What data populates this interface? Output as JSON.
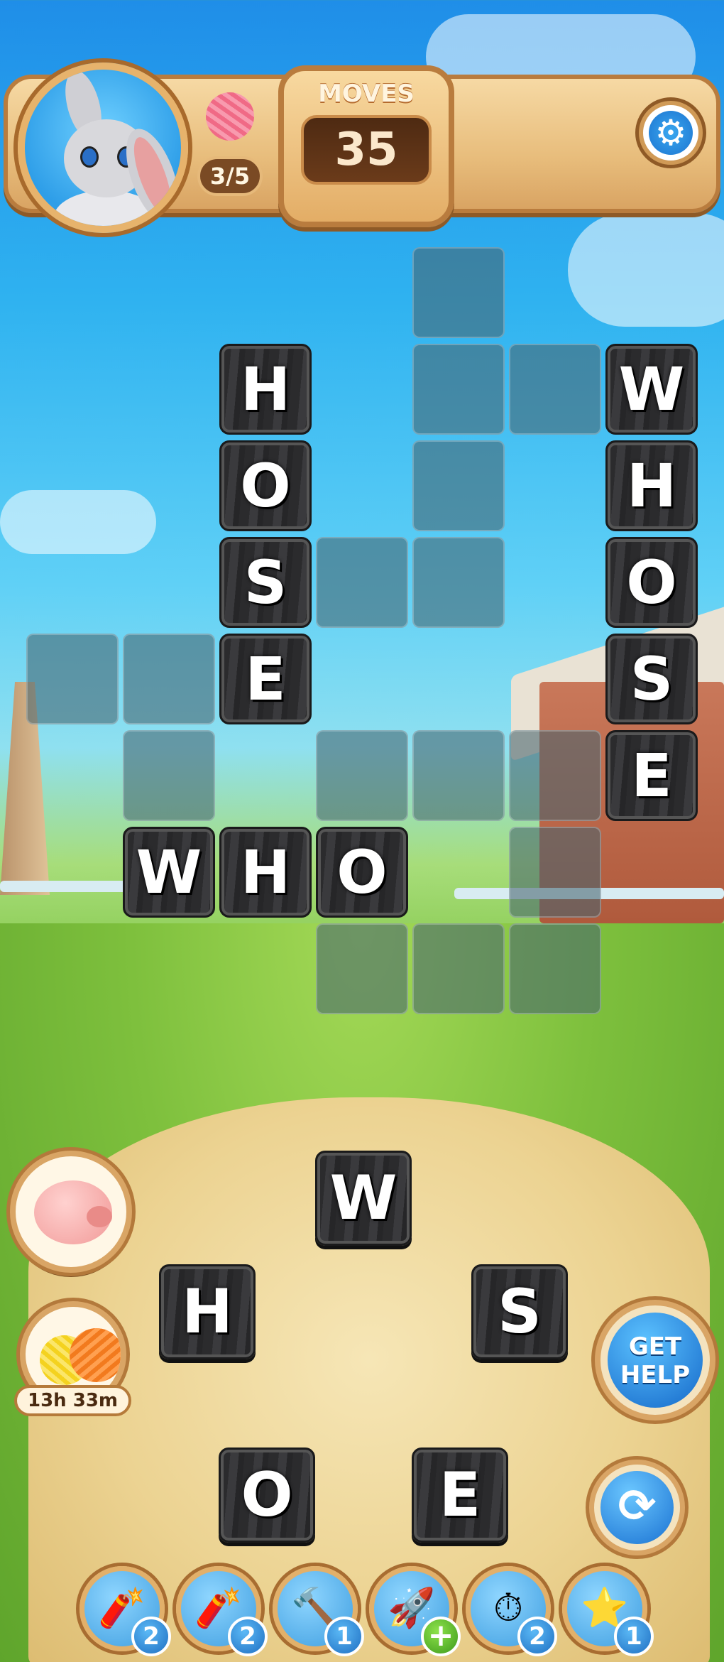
{
  "header": {
    "goal_progress": "3/5",
    "goal_item_icon": "yarn-ball-icon",
    "moves_label": "MOVES",
    "moves_value": "35",
    "settings_icon": "gear-icon"
  },
  "board": {
    "tiles": [
      {
        "id": "h1",
        "letter": "H"
      },
      {
        "id": "o1",
        "letter": "O"
      },
      {
        "id": "s1",
        "letter": "S"
      },
      {
        "id": "e1",
        "letter": "E"
      },
      {
        "id": "w2",
        "letter": "W"
      },
      {
        "id": "h2",
        "letter": "H"
      },
      {
        "id": "o2",
        "letter": "O"
      },
      {
        "id": "s2",
        "letter": "S"
      },
      {
        "id": "e2",
        "letter": "E"
      },
      {
        "id": "w3",
        "letter": "W"
      },
      {
        "id": "h3",
        "letter": "H"
      },
      {
        "id": "o3",
        "letter": "O"
      }
    ]
  },
  "letter_wheel": [
    "W",
    "H",
    "S",
    "O",
    "E"
  ],
  "side_buttons": {
    "piggy_bank_icon": "piggy-bank-icon",
    "yarn_offer_icon": "yarn-balls-icon",
    "yarn_offer_timer": "13h 33m",
    "get_help_label_1": "GET",
    "get_help_label_2": "HELP",
    "shuffle_icon": "shuffle-icon"
  },
  "boosters": [
    {
      "name": "firecracker",
      "icon": "firecracker-icon",
      "count": "2"
    },
    {
      "name": "dynamite",
      "icon": "dynamite-icon",
      "count": "2"
    },
    {
      "name": "hammer",
      "icon": "hammer-icon",
      "count": "1"
    },
    {
      "name": "rocket",
      "icon": "rocket-icon",
      "count": "+"
    },
    {
      "name": "stopwatch",
      "icon": "stopwatch-icon",
      "count": "2"
    },
    {
      "name": "magic-wand",
      "icon": "magic-wand-icon",
      "count": "1"
    }
  ]
}
